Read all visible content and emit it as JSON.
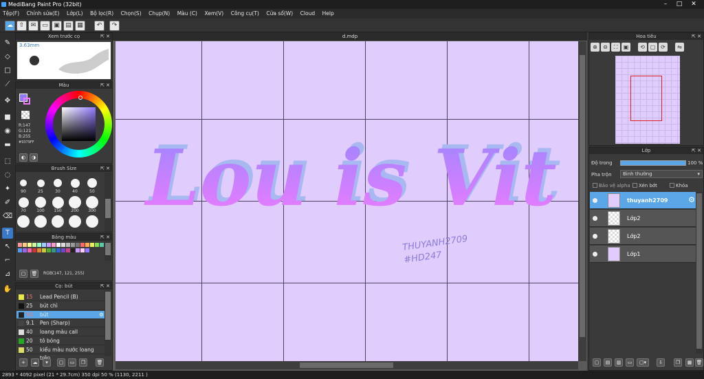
{
  "window": {
    "title": "MediBang Paint Pro (32bit)"
  },
  "menu": [
    "Tệp(F)",
    "Chỉnh sửa(E)",
    "Lớp(L)",
    "Bộ lọc(R)",
    "Chọn(S)",
    "Chụp(N)",
    "Màu (C)",
    "Xem(V)",
    "Công cụ(T)",
    "Cửa sổ(W)",
    "Cloud",
    "Help"
  ],
  "brush_preview": {
    "title": "Xem trước cọ",
    "size": "3.63mm"
  },
  "color_panel": {
    "title": "Màu",
    "r": "R:147",
    "g": "G:121",
    "b": "B:255",
    "hex": "#9379FF"
  },
  "brush_size": {
    "title": "Brush Size",
    "sizes": [
      "90",
      "25",
      "30",
      "40",
      "50",
      "70",
      "100",
      "150",
      "200",
      "300",
      "",
      "",
      "",
      "",
      ""
    ]
  },
  "palette": {
    "title": "Bảng màu",
    "rgb": "RGB(147, 121, 255)"
  },
  "brush_list": {
    "title": "Cọ: bút",
    "items": [
      {
        "size": "15",
        "name": "Lead Pencil (B)",
        "color": "#e8e84a"
      },
      {
        "size": "25",
        "name": "bút chì",
        "color": "#111111"
      },
      {
        "size": "50",
        "name": "bút",
        "color": "#222222"
      },
      {
        "size": "9.1",
        "name": "Pen (Sharp)",
        "color": "#444444"
      },
      {
        "size": "40",
        "name": "loang màu call",
        "color": "#dddddd"
      },
      {
        "size": "20",
        "name": "tô bóng",
        "color": "#22aa22"
      },
      {
        "size": "50",
        "name": "kiểu màu nước loang trên",
        "color": "#dddd66"
      }
    ]
  },
  "document": {
    "tab": "d.mdp",
    "art_text": "Lou is Vit",
    "watermark_line1": "THUYANH2709",
    "watermark_line2": "#HD247"
  },
  "navigator": {
    "title": "Hoa tiêu"
  },
  "layers": {
    "title": "Lớp",
    "opacity_label": "Độ trong",
    "opacity_value": "100 %",
    "blend_label": "Pha trộn",
    "blend_value": "Bình thường",
    "protect_alpha": "Bảo vệ alpha",
    "clipping": "Xén bớt",
    "lock": "Khóa",
    "items": [
      "thuyanh2709",
      "Lớp2",
      "Lớp2",
      "Lớp1"
    ]
  },
  "status": {
    "text": "2893 * 4092 pixel   (21 * 29.7cm)  350 dpi   50 %   (1130, 2211 )"
  },
  "colors": {
    "accent": "#5aa6e6",
    "canvas": "#e0cdfd",
    "text_grad_top": "#9d86ff",
    "text_grad_bottom": "#f07aff",
    "shadow": "#a8b8f0"
  },
  "icons": [
    "brush-icon",
    "eraser-icon",
    "select-icon",
    "move-icon",
    "fill-icon",
    "text-icon",
    "hand-icon",
    "undo-icon",
    "redo-icon",
    "zoom-in-icon",
    "zoom-out-icon"
  ]
}
